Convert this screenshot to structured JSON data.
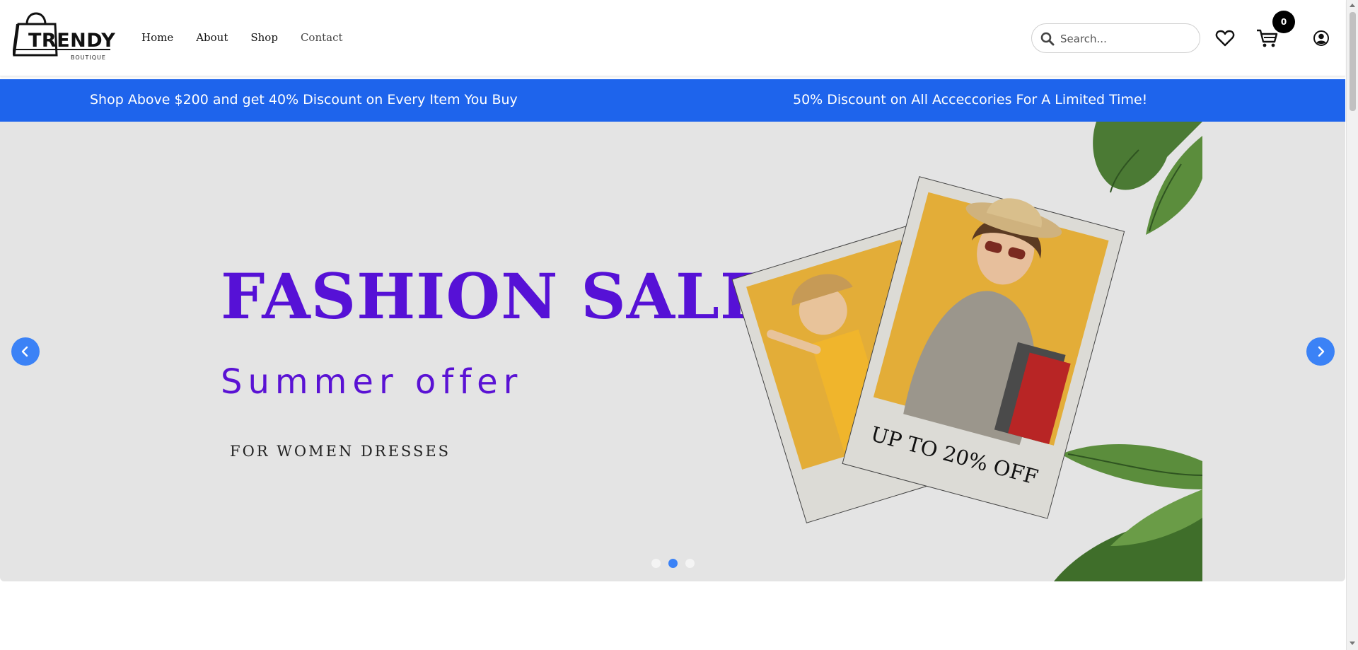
{
  "brand": {
    "name": "TRENDY",
    "tagline": "BOUTIQUE"
  },
  "nav": [
    {
      "label": "Home"
    },
    {
      "label": "About"
    },
    {
      "label": "Shop"
    },
    {
      "label": "Contact"
    }
  ],
  "search": {
    "placeholder": "Search...",
    "value": ""
  },
  "icons": {
    "search": "search-icon",
    "wishlist": "heart-icon",
    "cart": "cart-icon",
    "account": "user-circle-icon"
  },
  "cart": {
    "count": "0"
  },
  "promo": {
    "left": "Shop Above $200 and get 40% Discount on Every Item You Buy",
    "right": "50% Discount on All Acceccories For A Limited Time!",
    "color": "#1e64ec"
  },
  "hero": {
    "title": "FASHION SALE!",
    "subtitle": "Summer offer",
    "note": "FOR WOMEN DRESSES",
    "offer": "UP TO 20% OFF",
    "accent": "#5611d6",
    "slides": 3,
    "active_slide": 2
  }
}
